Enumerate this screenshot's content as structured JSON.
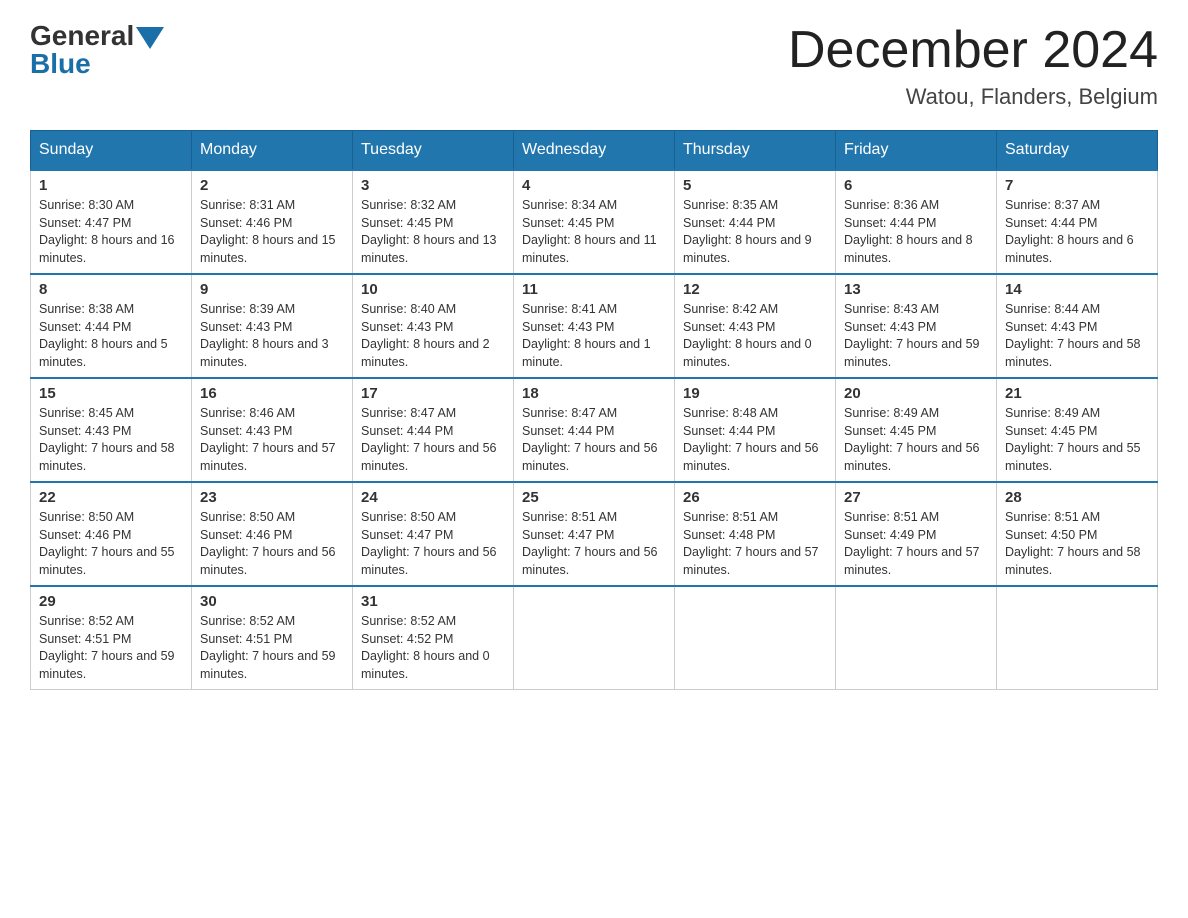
{
  "header": {
    "logo_general": "General",
    "logo_blue": "Blue",
    "month_title": "December 2024",
    "location": "Watou, Flanders, Belgium"
  },
  "days_of_week": [
    "Sunday",
    "Monday",
    "Tuesday",
    "Wednesday",
    "Thursday",
    "Friday",
    "Saturday"
  ],
  "weeks": [
    [
      {
        "day": "1",
        "sunrise": "8:30 AM",
        "sunset": "4:47 PM",
        "daylight": "8 hours and 16 minutes."
      },
      {
        "day": "2",
        "sunrise": "8:31 AM",
        "sunset": "4:46 PM",
        "daylight": "8 hours and 15 minutes."
      },
      {
        "day": "3",
        "sunrise": "8:32 AM",
        "sunset": "4:45 PM",
        "daylight": "8 hours and 13 minutes."
      },
      {
        "day": "4",
        "sunrise": "8:34 AM",
        "sunset": "4:45 PM",
        "daylight": "8 hours and 11 minutes."
      },
      {
        "day": "5",
        "sunrise": "8:35 AM",
        "sunset": "4:44 PM",
        "daylight": "8 hours and 9 minutes."
      },
      {
        "day": "6",
        "sunrise": "8:36 AM",
        "sunset": "4:44 PM",
        "daylight": "8 hours and 8 minutes."
      },
      {
        "day": "7",
        "sunrise": "8:37 AM",
        "sunset": "4:44 PM",
        "daylight": "8 hours and 6 minutes."
      }
    ],
    [
      {
        "day": "8",
        "sunrise": "8:38 AM",
        "sunset": "4:44 PM",
        "daylight": "8 hours and 5 minutes."
      },
      {
        "day": "9",
        "sunrise": "8:39 AM",
        "sunset": "4:43 PM",
        "daylight": "8 hours and 3 minutes."
      },
      {
        "day": "10",
        "sunrise": "8:40 AM",
        "sunset": "4:43 PM",
        "daylight": "8 hours and 2 minutes."
      },
      {
        "day": "11",
        "sunrise": "8:41 AM",
        "sunset": "4:43 PM",
        "daylight": "8 hours and 1 minute."
      },
      {
        "day": "12",
        "sunrise": "8:42 AM",
        "sunset": "4:43 PM",
        "daylight": "8 hours and 0 minutes."
      },
      {
        "day": "13",
        "sunrise": "8:43 AM",
        "sunset": "4:43 PM",
        "daylight": "7 hours and 59 minutes."
      },
      {
        "day": "14",
        "sunrise": "8:44 AM",
        "sunset": "4:43 PM",
        "daylight": "7 hours and 58 minutes."
      }
    ],
    [
      {
        "day": "15",
        "sunrise": "8:45 AM",
        "sunset": "4:43 PM",
        "daylight": "7 hours and 58 minutes."
      },
      {
        "day": "16",
        "sunrise": "8:46 AM",
        "sunset": "4:43 PM",
        "daylight": "7 hours and 57 minutes."
      },
      {
        "day": "17",
        "sunrise": "8:47 AM",
        "sunset": "4:44 PM",
        "daylight": "7 hours and 56 minutes."
      },
      {
        "day": "18",
        "sunrise": "8:47 AM",
        "sunset": "4:44 PM",
        "daylight": "7 hours and 56 minutes."
      },
      {
        "day": "19",
        "sunrise": "8:48 AM",
        "sunset": "4:44 PM",
        "daylight": "7 hours and 56 minutes."
      },
      {
        "day": "20",
        "sunrise": "8:49 AM",
        "sunset": "4:45 PM",
        "daylight": "7 hours and 56 minutes."
      },
      {
        "day": "21",
        "sunrise": "8:49 AM",
        "sunset": "4:45 PM",
        "daylight": "7 hours and 55 minutes."
      }
    ],
    [
      {
        "day": "22",
        "sunrise": "8:50 AM",
        "sunset": "4:46 PM",
        "daylight": "7 hours and 55 minutes."
      },
      {
        "day": "23",
        "sunrise": "8:50 AM",
        "sunset": "4:46 PM",
        "daylight": "7 hours and 56 minutes."
      },
      {
        "day": "24",
        "sunrise": "8:50 AM",
        "sunset": "4:47 PM",
        "daylight": "7 hours and 56 minutes."
      },
      {
        "day": "25",
        "sunrise": "8:51 AM",
        "sunset": "4:47 PM",
        "daylight": "7 hours and 56 minutes."
      },
      {
        "day": "26",
        "sunrise": "8:51 AM",
        "sunset": "4:48 PM",
        "daylight": "7 hours and 57 minutes."
      },
      {
        "day": "27",
        "sunrise": "8:51 AM",
        "sunset": "4:49 PM",
        "daylight": "7 hours and 57 minutes."
      },
      {
        "day": "28",
        "sunrise": "8:51 AM",
        "sunset": "4:50 PM",
        "daylight": "7 hours and 58 minutes."
      }
    ],
    [
      {
        "day": "29",
        "sunrise": "8:52 AM",
        "sunset": "4:51 PM",
        "daylight": "7 hours and 59 minutes."
      },
      {
        "day": "30",
        "sunrise": "8:52 AM",
        "sunset": "4:51 PM",
        "daylight": "7 hours and 59 minutes."
      },
      {
        "day": "31",
        "sunrise": "8:52 AM",
        "sunset": "4:52 PM",
        "daylight": "8 hours and 0 minutes."
      },
      null,
      null,
      null,
      null
    ]
  ]
}
